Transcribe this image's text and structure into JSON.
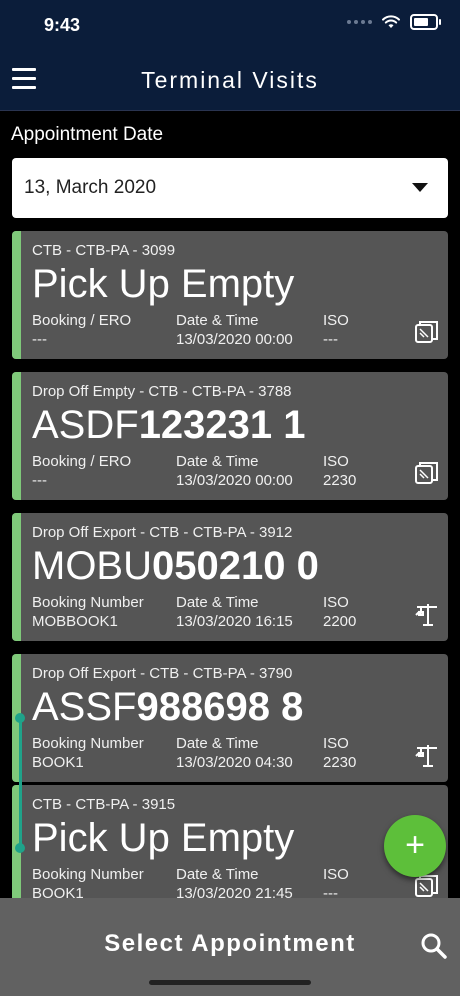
{
  "status": {
    "time": "9:43"
  },
  "nav": {
    "title": "Terminal Visits"
  },
  "filter": {
    "label": "Appointment Date",
    "date_value": "13, March 2020"
  },
  "cards": [
    {
      "header": "CTB - CTB-PA - 3099",
      "big_prefix": "Pick Up Empty",
      "big_bold": "",
      "col1_label": "Booking / ERO",
      "col1_value": "---",
      "col2_label": "Date & Time",
      "col2_value": "13/03/2020 00:00",
      "col3_label": "ISO",
      "col3_value": "---",
      "icon": "container-icon"
    },
    {
      "header": "Drop Off Empty - CTB - CTB-PA - 3788",
      "big_prefix": "ASDF",
      "big_bold": "123231 1",
      "col1_label": "Booking / ERO",
      "col1_value": "---",
      "col2_label": "Date & Time",
      "col2_value": "13/03/2020 00:00",
      "col3_label": "ISO",
      "col3_value": "2230",
      "icon": "container-icon"
    },
    {
      "header": "Drop Off Export - CTB - CTB-PA - 3912",
      "big_prefix": "MOBU",
      "big_bold": "050210 0",
      "col1_label": "Booking Number",
      "col1_value": "MOBBOOK1",
      "col2_label": "Date & Time",
      "col2_value": "13/03/2020 16:15",
      "col3_label": "ISO",
      "col3_value": "2200",
      "icon": "crane-icon"
    },
    {
      "header": "Drop Off Export - CTB - CTB-PA - 3790",
      "big_prefix": "ASSF",
      "big_bold": "988698 8",
      "col1_label": "Booking Number",
      "col1_value": "BOOK1",
      "col2_label": "Date & Time",
      "col2_value": "13/03/2020 04:30",
      "col3_label": "ISO",
      "col3_value": "2230",
      "icon": "crane-icon"
    },
    {
      "header": "CTB - CTB-PA - 3915",
      "big_prefix": "Pick Up Empty",
      "big_bold": "",
      "col1_label": "Booking Number",
      "col1_value": "BOOK1",
      "col2_label": "Date & Time",
      "col2_value": "13/03/2020 21:45",
      "col3_label": "ISO",
      "col3_value": "---",
      "icon": "container-icon"
    }
  ],
  "fab": {
    "symbol": "+"
  },
  "bottom": {
    "label": "Select Appointment"
  },
  "colors": {
    "nav_bg": "#0b1d3a",
    "card_bg": "#555555",
    "accent_green": "#7fc97a",
    "fab_green": "#5dbf3a",
    "timeline": "#1fa38a"
  }
}
